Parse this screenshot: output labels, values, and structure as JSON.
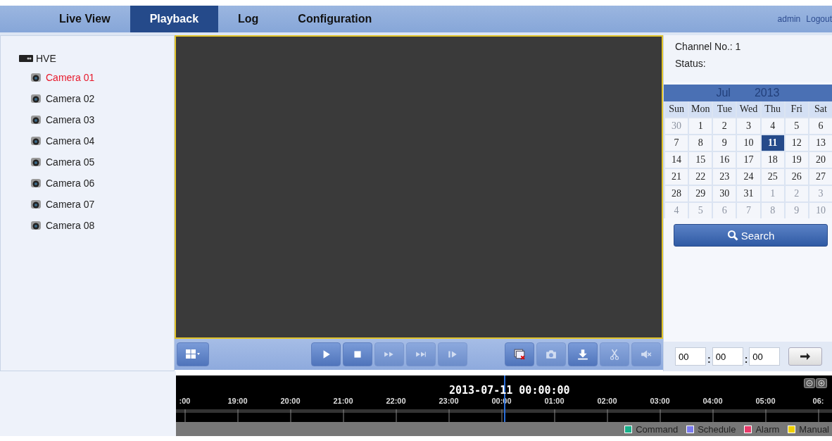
{
  "nav": {
    "tabs": [
      {
        "label": "Live View",
        "selected": false
      },
      {
        "label": "Playback",
        "selected": true
      },
      {
        "label": "Log",
        "selected": false
      },
      {
        "label": "Configuration",
        "selected": false
      }
    ],
    "user": "admin",
    "logout": "Logout"
  },
  "tree": {
    "label": "HVE",
    "children": [
      {
        "label": "Camera 01",
        "selected": true
      },
      {
        "label": "Camera 02",
        "selected": false
      },
      {
        "label": "Camera 03",
        "selected": false
      },
      {
        "label": "Camera 04",
        "selected": false
      },
      {
        "label": "Camera 05",
        "selected": false
      },
      {
        "label": "Camera 06",
        "selected": false
      },
      {
        "label": "Camera 07",
        "selected": false
      },
      {
        "label": "Camera 08",
        "selected": false
      }
    ]
  },
  "toolbar": {
    "left": [
      {
        "kind": "layout",
        "disabled": false
      }
    ],
    "center": [
      {
        "kind": "play",
        "disabled": false
      },
      {
        "kind": "stop",
        "disabled": false
      },
      {
        "kind": "slow",
        "disabled": true
      },
      {
        "kind": "fast",
        "disabled": true
      },
      {
        "kind": "frame",
        "disabled": true
      }
    ],
    "right": [
      {
        "kind": "stopall",
        "disabled": false
      },
      {
        "kind": "capture",
        "disabled": true
      },
      {
        "kind": "download",
        "disabled": false
      },
      {
        "kind": "clip",
        "disabled": true
      },
      {
        "kind": "audio",
        "disabled": true
      }
    ]
  },
  "info": {
    "channel": "Channel No.: 1",
    "status": "Status:"
  },
  "calendar": {
    "month": "Jul",
    "year": "2013",
    "weekdays": [
      "Sun",
      "Mon",
      "Tue",
      "Wed",
      "Thu",
      "Fri",
      "Sat"
    ],
    "days": [
      {
        "day": "30",
        "other": true,
        "selected": false
      },
      {
        "day": "1",
        "other": false,
        "selected": false
      },
      {
        "day": "2",
        "other": false,
        "selected": false
      },
      {
        "day": "3",
        "other": false,
        "selected": false
      },
      {
        "day": "4",
        "other": false,
        "selected": false
      },
      {
        "day": "5",
        "other": false,
        "selected": false
      },
      {
        "day": "6",
        "other": false,
        "selected": false
      },
      {
        "day": "7",
        "other": false,
        "selected": false
      },
      {
        "day": "8",
        "other": false,
        "selected": false
      },
      {
        "day": "9",
        "other": false,
        "selected": false
      },
      {
        "day": "10",
        "other": false,
        "selected": false
      },
      {
        "day": "11",
        "other": false,
        "selected": true
      },
      {
        "day": "12",
        "other": false,
        "selected": false
      },
      {
        "day": "13",
        "other": false,
        "selected": false
      },
      {
        "day": "14",
        "other": false,
        "selected": false
      },
      {
        "day": "15",
        "other": false,
        "selected": false
      },
      {
        "day": "16",
        "other": false,
        "selected": false
      },
      {
        "day": "17",
        "other": false,
        "selected": false
      },
      {
        "day": "18",
        "other": false,
        "selected": false
      },
      {
        "day": "19",
        "other": false,
        "selected": false
      },
      {
        "day": "20",
        "other": false,
        "selected": false
      },
      {
        "day": "21",
        "other": false,
        "selected": false
      },
      {
        "day": "22",
        "other": false,
        "selected": false
      },
      {
        "day": "23",
        "other": false,
        "selected": false
      },
      {
        "day": "24",
        "other": false,
        "selected": false
      },
      {
        "day": "25",
        "other": false,
        "selected": false
      },
      {
        "day": "26",
        "other": false,
        "selected": false
      },
      {
        "day": "27",
        "other": false,
        "selected": false
      },
      {
        "day": "28",
        "other": false,
        "selected": false
      },
      {
        "day": "29",
        "other": false,
        "selected": false
      },
      {
        "day": "30",
        "other": false,
        "selected": false
      },
      {
        "day": "31",
        "other": false,
        "selected": false
      },
      {
        "day": "1",
        "other": true,
        "selected": false
      },
      {
        "day": "2",
        "other": true,
        "selected": false
      },
      {
        "day": "3",
        "other": true,
        "selected": false
      },
      {
        "day": "4",
        "other": true,
        "selected": false
      },
      {
        "day": "5",
        "other": true,
        "selected": false
      },
      {
        "day": "6",
        "other": true,
        "selected": false
      },
      {
        "day": "7",
        "other": true,
        "selected": false
      },
      {
        "day": "8",
        "other": true,
        "selected": false
      },
      {
        "day": "9",
        "other": true,
        "selected": false
      },
      {
        "day": "10",
        "other": true,
        "selected": false
      }
    ]
  },
  "search": "Search",
  "time": {
    "hours": "00",
    "minutes": "00",
    "seconds": "00",
    "separator": ":"
  },
  "timeline": {
    "current": "2013-07-11 00:00:00",
    "ticks": [
      ":00",
      "19:00",
      "20:00",
      "21:00",
      "22:00",
      "23:00",
      "00:00",
      "01:00",
      "02:00",
      "03:00",
      "04:00",
      "05:00",
      "06:"
    ],
    "legend": [
      {
        "label": "Command",
        "color": "#19b08a"
      },
      {
        "label": "Schedule",
        "color": "#7b7bef"
      },
      {
        "label": "Alarm",
        "color": "#e83a6a"
      },
      {
        "label": "Manual",
        "color": "#f0d000"
      }
    ]
  }
}
